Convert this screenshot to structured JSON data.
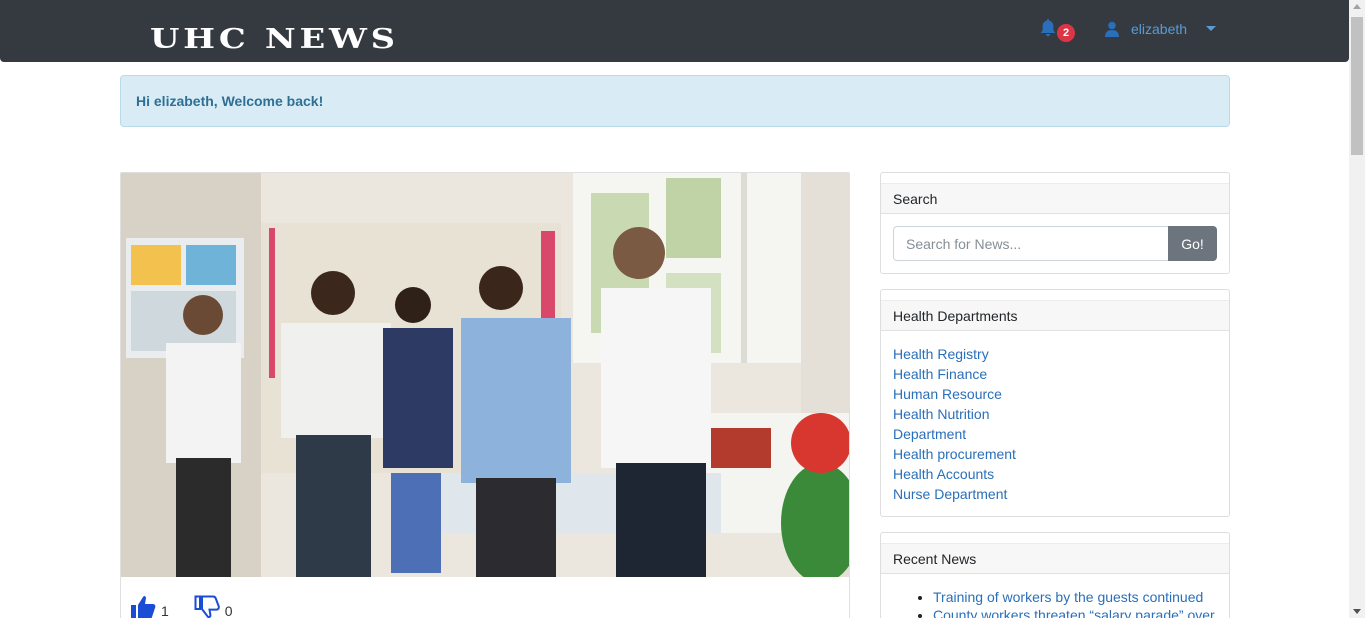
{
  "navbar": {
    "brand": "UHC NEWS",
    "notifications": {
      "icon": "bell-icon",
      "count": "2"
    },
    "user": {
      "icon": "user-icon",
      "name": "elizabeth",
      "dropdown_icon": "caret-down-icon"
    }
  },
  "alert": {
    "message": "Hi elizabeth, Welcome back!"
  },
  "post": {
    "image_icon": "news-photo",
    "likes": "1",
    "dislikes": "0",
    "like_icon": "thumbs-up-icon",
    "dislike_icon": "thumbs-down-icon"
  },
  "search": {
    "title": "Search",
    "placeholder": "Search for News...",
    "button": "Go!"
  },
  "departments": {
    "title": "Health Departments",
    "items": [
      "Health Registry",
      "Health Finance",
      "Human Resource",
      "Health Nutrition",
      "Department",
      "Health procurement",
      "Health Accounts",
      "Nurse Department"
    ]
  },
  "recent": {
    "title": "Recent News",
    "items": [
      "Training of workers by the guests continued",
      "County workers threaten “salary parade” over"
    ]
  },
  "colors": {
    "navbar": "#343a40",
    "alert_bg": "#d9ecf6",
    "alert_text": "#2f6f93",
    "link": "#2a6fba",
    "badge": "#dc3545",
    "go_button": "#6c757d"
  }
}
